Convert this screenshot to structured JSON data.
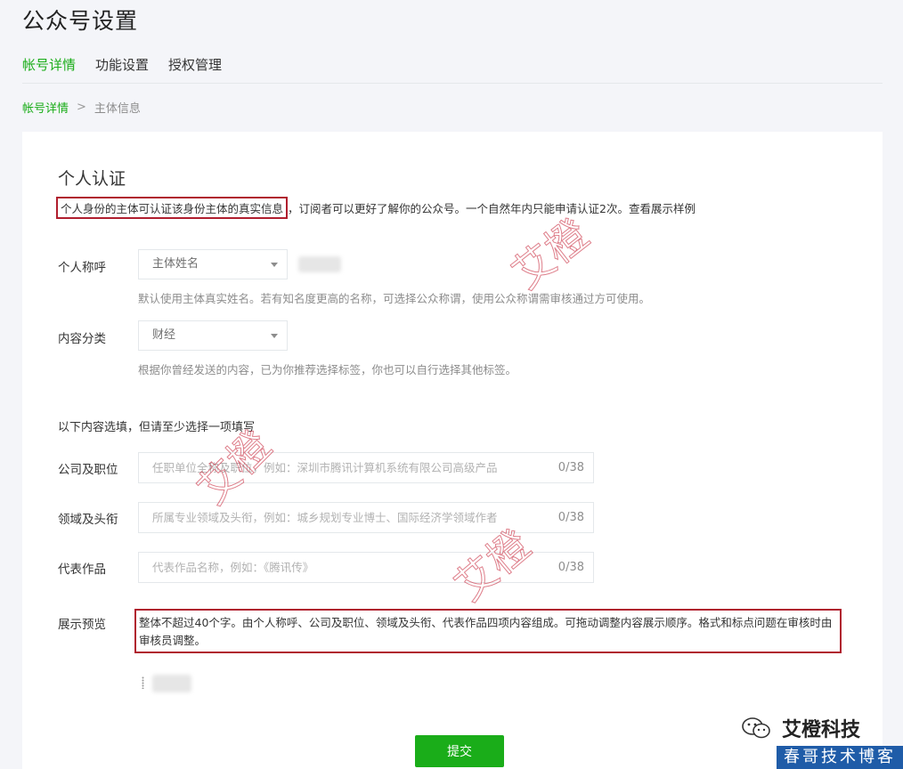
{
  "header": {
    "title": "公众号设置",
    "tabs": [
      {
        "label": "帐号详情",
        "active": true
      },
      {
        "label": "功能设置",
        "active": false
      },
      {
        "label": "授权管理",
        "active": false
      }
    ]
  },
  "breadcrumb": {
    "parent": "帐号详情",
    "separator": ">",
    "current": "主体信息"
  },
  "section": {
    "title": "个人认证",
    "desc_highlight": "个人身份的主体可认证该身份主体的真实信息",
    "desc_rest": "，订阅者可以更好了解你的公众号。一个自然年内只能申请认证2次。",
    "desc_link": "查看展示样例"
  },
  "form": {
    "name_label": "个人称呼",
    "name_select": "主体姓名",
    "name_tip": "默认使用主体真实姓名。若有知名度更高的名称，可选择公众称谓，使用公众称谓需审核通过方可使用。",
    "category_label": "内容分类",
    "category_select": "财经",
    "category_tip": "根据你曾经发送的内容，已为你推荐选择标签，你也可以自行选择其他标签。",
    "optional_hint": "以下内容选填，但请至少选择一项填写",
    "company_label": "公司及职位",
    "company_placeholder": "任职单位全称及职位，例如：深圳市腾讯计算机系统有限公司高级产品",
    "company_counter": "0/38",
    "field_label": "领域及头衔",
    "field_placeholder": "所属专业领域及头衔，例如：城乡规划专业博士、国际经济学领域作者",
    "field_counter": "0/38",
    "works_label": "代表作品",
    "works_placeholder": "代表作品名称，例如：《腾讯传》",
    "works_counter": "0/38",
    "preview_label": "展示预览",
    "preview_text": "整体不超过40个字。由个人称呼、公司及职位、领域及头衔、代表作品四项内容组成。可拖动调整内容展示顺序。格式和标点问题在审核时由审核员调整。",
    "submit_label": "提交"
  },
  "watermarks": {
    "text": "艾橙"
  },
  "branding": {
    "account_name": "艾橙科技",
    "blog_name": "春哥技术博客"
  },
  "colors": {
    "accent": "#1aad19",
    "highlight_border": "#b01e2e",
    "blog_badge": "#1f5ca8"
  }
}
